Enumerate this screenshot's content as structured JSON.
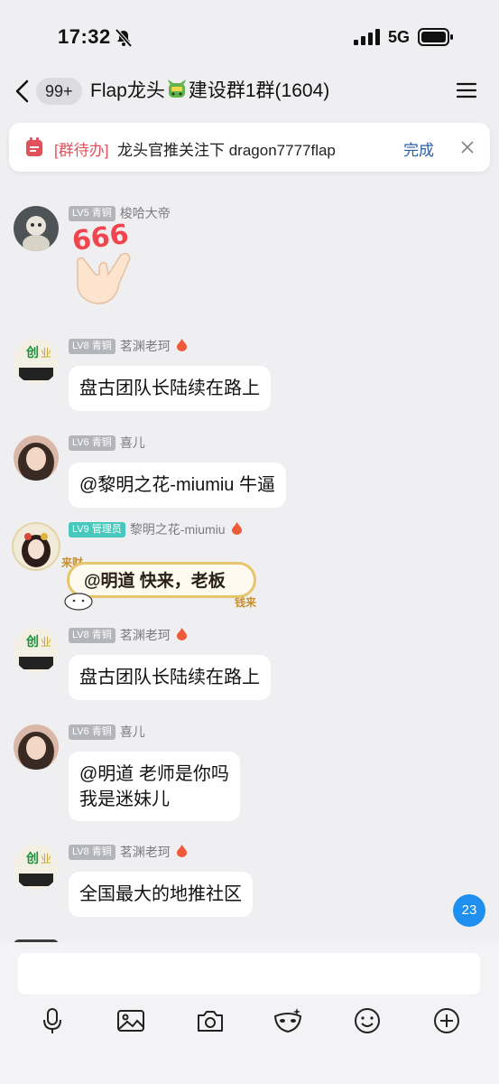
{
  "status_bar": {
    "time": "17:32",
    "network": "5G"
  },
  "header": {
    "unread_badge": "99+",
    "group_title_prefix": "Flap龙头",
    "group_title_suffix": "建设群1群(1604)"
  },
  "pending_bar": {
    "tag": "[群待办]",
    "text": "龙头官推关注下 dragon7777flap",
    "done_label": "完成"
  },
  "messages": [
    {
      "level": "LV5 青铜",
      "nickname": "梭哈大帝",
      "sticker_text": "666"
    },
    {
      "level": "LV8 青铜",
      "nickname": "茗渊老珂",
      "text": "盘古团队长陆续在路上"
    },
    {
      "level": "LV6 青铜",
      "nickname": "喜儿",
      "text": "@黎明之花-miumiu 牛逼"
    },
    {
      "level": "LV9 管理员",
      "nickname": "黎明之花-miumiu",
      "text": "@明道 快来，老板",
      "deco_left": "来财",
      "deco_right": "钱来"
    },
    {
      "level": "LV8 青铜",
      "nickname": "茗渊老珂",
      "text": "盘古团队长陆续在路上"
    },
    {
      "level": "LV6 青铜",
      "nickname": "喜儿",
      "line1": "@明道 老师是你吗",
      "line2": "我是迷妹儿"
    },
    {
      "level": "LV8 青铜",
      "nickname": "茗渊老珂",
      "text": "全国最大的地推社区"
    }
  ],
  "new_message_count": "23",
  "icons": [
    "back-chevron-icon",
    "menu-icon",
    "todo-icon",
    "close-icon",
    "microphone-icon",
    "image-icon",
    "camera-icon",
    "mask-icon",
    "emoji-icon",
    "plus-icon"
  ],
  "colors": {
    "accent_blue": "#1e8fef",
    "todo_red": "#e0525b",
    "admin_teal": "#46c8bd",
    "level_grey": "#b4b5bb"
  }
}
